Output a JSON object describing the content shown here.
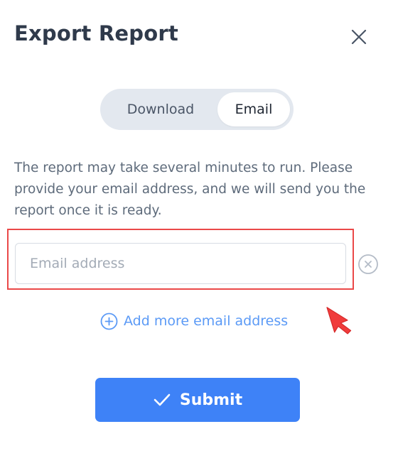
{
  "dialog": {
    "title": "Export Report",
    "close_icon": "close-icon"
  },
  "toggle": {
    "options": [
      {
        "label": "Download",
        "selected": false
      },
      {
        "label": "Email",
        "selected": true
      }
    ]
  },
  "description": "The report may take several minutes to run. Please provide your email address, and we will send you the report once it is ready.",
  "email_field": {
    "value": "",
    "placeholder": "Email address",
    "remove_icon": "remove-circle-icon"
  },
  "add_more": {
    "label": "Add more email address",
    "icon": "plus-circle-icon"
  },
  "submit": {
    "label": "Submit",
    "icon": "check-icon"
  },
  "colors": {
    "accent": "#3e82f7",
    "link": "#5b9af6",
    "highlight": "#ea4848",
    "title": "#2f3a4b"
  }
}
